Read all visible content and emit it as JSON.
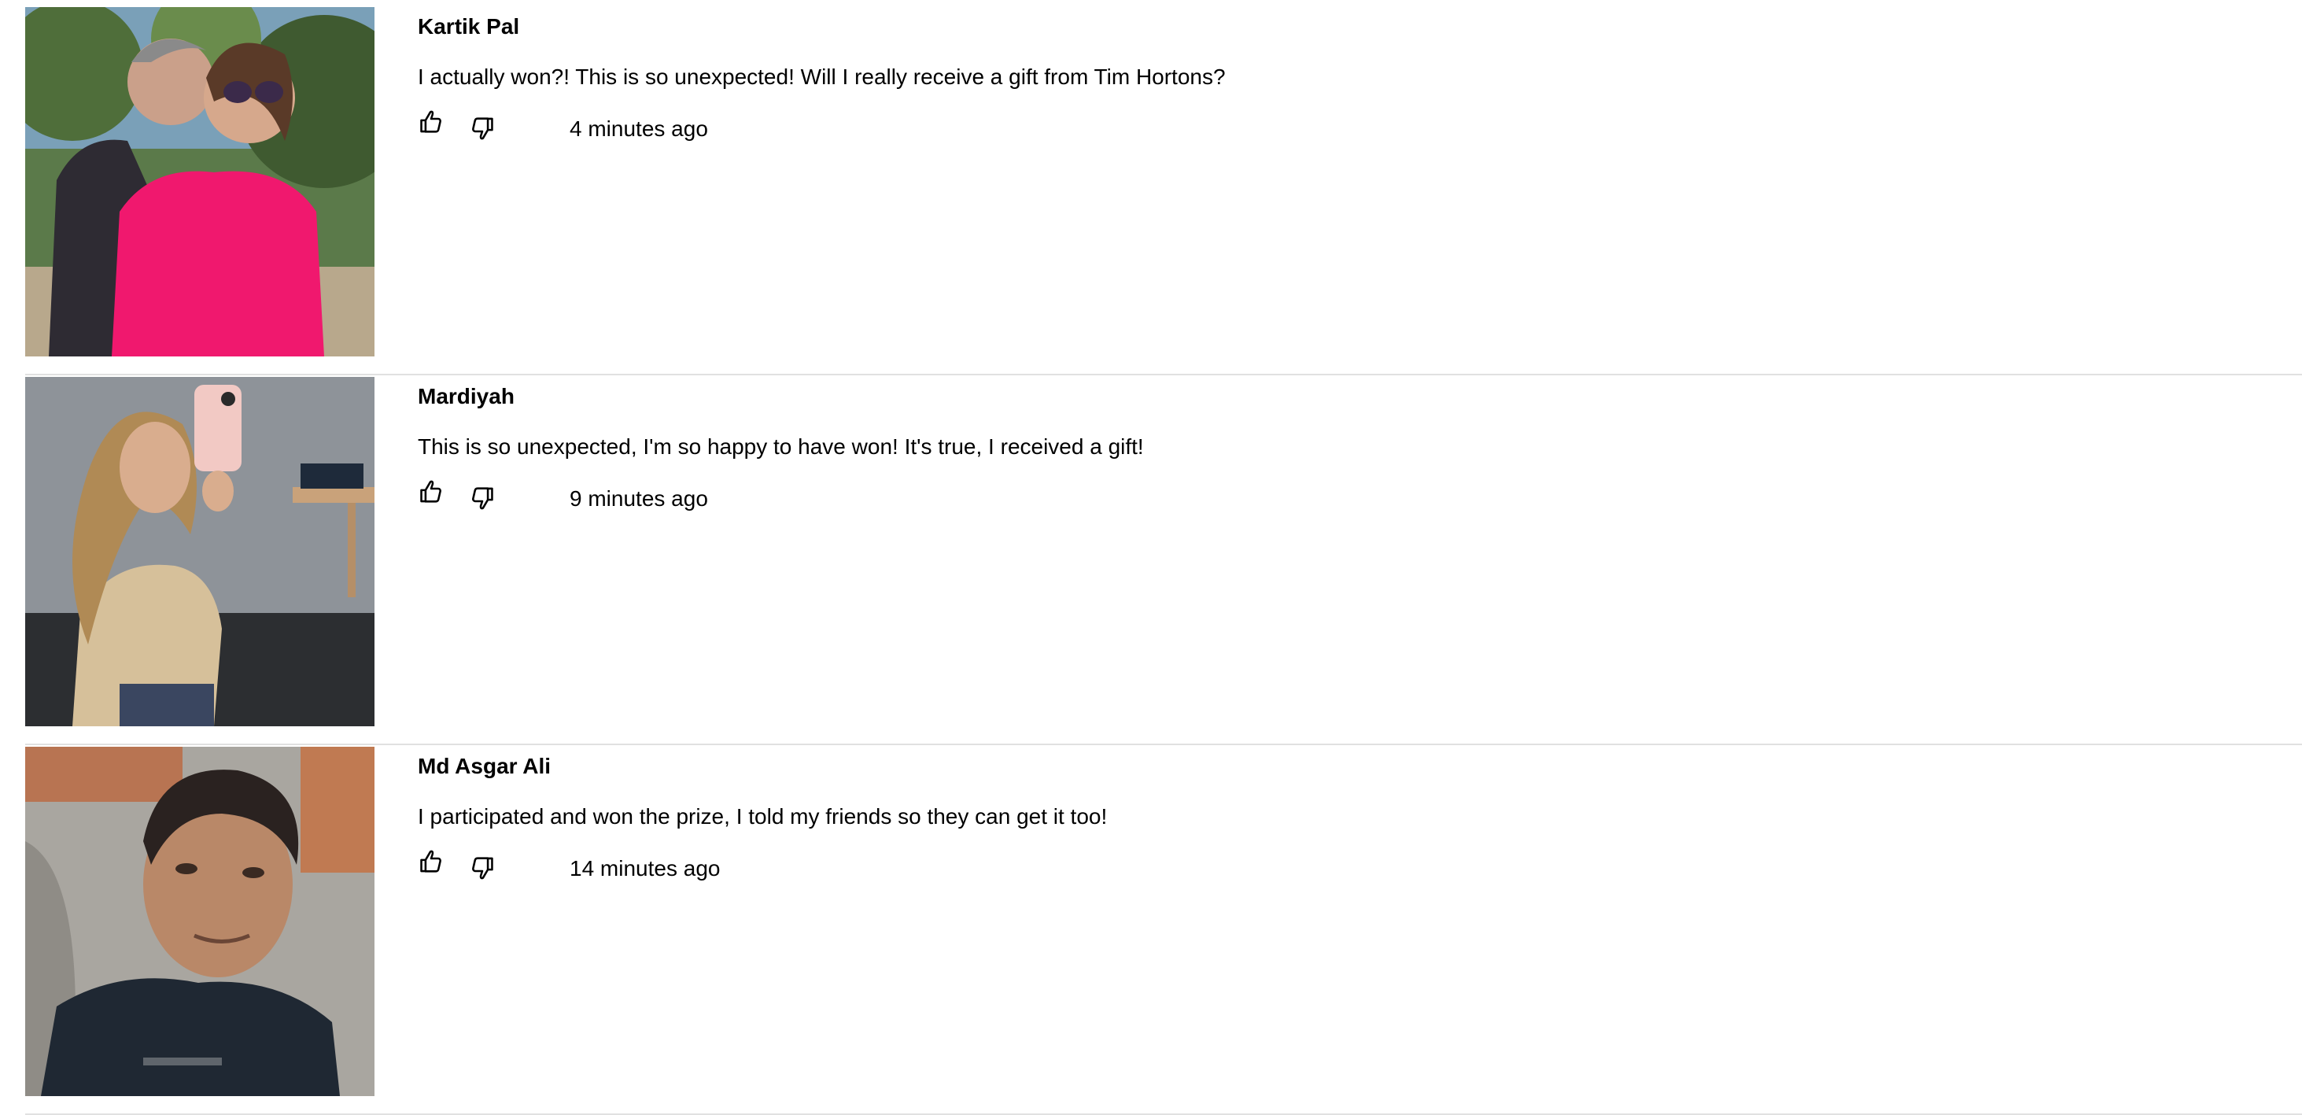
{
  "comments": [
    {
      "name": "Kartik Pal",
      "text": "I actually won?! This is so unexpected! Will I really receive a gift from Tim Hortons?",
      "time": "4 minutes ago",
      "like_icon": "thumbs-up-icon",
      "dislike_icon": "thumbs-down-icon"
    },
    {
      "name": "Mardiyah",
      "text": "This is so unexpected, I'm so happy to have won! It's true, I received a gift!",
      "time": "9 minutes ago",
      "like_icon": "thumbs-up-icon",
      "dislike_icon": "thumbs-down-icon"
    },
    {
      "name": "Md Asgar Ali",
      "text": "I participated and won the prize, I told my friends so they can get it too!",
      "time": "14 minutes ago",
      "like_icon": "thumbs-up-icon",
      "dislike_icon": "thumbs-down-icon"
    }
  ],
  "colors": {
    "text": "#000000",
    "divider": "#e1e1e1",
    "background": "#ffffff"
  }
}
